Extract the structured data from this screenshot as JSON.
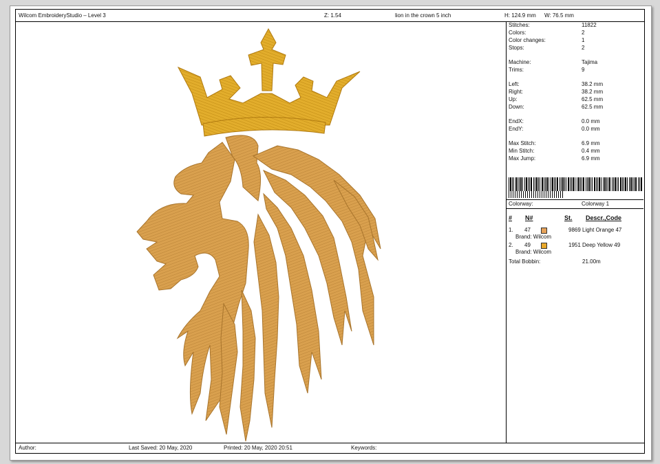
{
  "header": {
    "app_title": "Wilcom EmbroideryStudio – Level 3",
    "zoom": "Z: 1.54",
    "design_name": "lion in the crown 5 inch",
    "height": "H: 124.9 mm",
    "width": "W: 76.5 mm"
  },
  "stats": [
    {
      "label": "Stitches:",
      "value": "11822"
    },
    {
      "label": "Colors:",
      "value": "2"
    },
    {
      "label": "Color changes:",
      "value": "1"
    },
    {
      "label": "Stops:",
      "value": "2"
    },
    {
      "label": "Machine:",
      "value": "Tajima"
    },
    {
      "label": "Trims:",
      "value": "9"
    },
    {
      "label": "Left:",
      "value": "38.2 mm"
    },
    {
      "label": "Right:",
      "value": "38.2 mm"
    },
    {
      "label": "Up:",
      "value": "62.5 mm"
    },
    {
      "label": "Down:",
      "value": "62.5 mm"
    },
    {
      "label": "EndX:",
      "value": "0.0 mm"
    },
    {
      "label": "EndY:",
      "value": "0.0 mm"
    },
    {
      "label": "Max Stitch:",
      "value": "6.9 mm"
    },
    {
      "label": "Min Stitch:",
      "value": "0.4 mm"
    },
    {
      "label": "Max Jump:",
      "value": "6.9 mm"
    }
  ],
  "colorway": {
    "label": "Colorway:",
    "value": "Colorway 1"
  },
  "color_table": {
    "headers": {
      "num": "#",
      "n": "N#",
      "st": "St.",
      "descr": "Descr.,Code"
    },
    "rows": [
      {
        "index": "1.",
        "n": "47",
        "stitches": "9869",
        "descr": "Light Orange 47",
        "brand": "Brand: Wilcom",
        "color": "#e6a25a"
      },
      {
        "index": "2.",
        "n": "49",
        "stitches": "1951",
        "descr": "Deep Yellow 49",
        "brand": "Brand: Wilcom",
        "color": "#e8a82a"
      }
    ],
    "total_label": "Total Bobbin:",
    "total_value": "21.00m"
  },
  "footer": {
    "author": "Author:",
    "last_saved": "Last Saved: 20 May, 2020",
    "printed": "Printed: 20 May, 2020 20:51",
    "keywords": "Keywords:"
  },
  "colors": {
    "mane": "#d9a04e",
    "crown": "#e2ad2c"
  }
}
